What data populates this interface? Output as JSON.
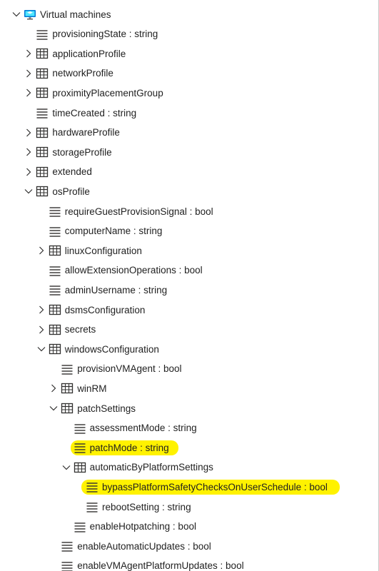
{
  "tree": {
    "nodes": [
      {
        "label": "Virtual machines",
        "depth": 0,
        "kind": "root",
        "chevron": "expanded",
        "name": "tree-root-virtual-machines"
      },
      {
        "label": "provisioningState : string",
        "depth": 1,
        "kind": "field",
        "chevron": "none",
        "name": "tree-field-provisioningstate"
      },
      {
        "label": "applicationProfile",
        "depth": 1,
        "kind": "table",
        "chevron": "collapsed",
        "name": "tree-node-applicationprofile"
      },
      {
        "label": "networkProfile",
        "depth": 1,
        "kind": "table",
        "chevron": "collapsed",
        "name": "tree-node-networkprofile"
      },
      {
        "label": "proximityPlacementGroup",
        "depth": 1,
        "kind": "table",
        "chevron": "collapsed",
        "name": "tree-node-proximityplacementgroup"
      },
      {
        "label": "timeCreated : string",
        "depth": 1,
        "kind": "field",
        "chevron": "none",
        "name": "tree-field-timecreated"
      },
      {
        "label": "hardwareProfile",
        "depth": 1,
        "kind": "table",
        "chevron": "collapsed",
        "name": "tree-node-hardwareprofile"
      },
      {
        "label": "storageProfile",
        "depth": 1,
        "kind": "table",
        "chevron": "collapsed",
        "name": "tree-node-storageprofile"
      },
      {
        "label": "extended",
        "depth": 1,
        "kind": "table",
        "chevron": "collapsed",
        "name": "tree-node-extended"
      },
      {
        "label": "osProfile",
        "depth": 1,
        "kind": "table",
        "chevron": "expanded",
        "name": "tree-node-osprofile"
      },
      {
        "label": "requireGuestProvisionSignal : bool",
        "depth": 2,
        "kind": "field",
        "chevron": "none",
        "name": "tree-field-requireguestprovisionsignal"
      },
      {
        "label": "computerName : string",
        "depth": 2,
        "kind": "field",
        "chevron": "none",
        "name": "tree-field-computername"
      },
      {
        "label": "linuxConfiguration",
        "depth": 2,
        "kind": "table",
        "chevron": "collapsed",
        "name": "tree-node-linuxconfiguration"
      },
      {
        "label": "allowExtensionOperations : bool",
        "depth": 2,
        "kind": "field",
        "chevron": "none",
        "name": "tree-field-allowextensionoperations"
      },
      {
        "label": "adminUsername : string",
        "depth": 2,
        "kind": "field",
        "chevron": "none",
        "name": "tree-field-adminusername"
      },
      {
        "label": "dsmsConfiguration",
        "depth": 2,
        "kind": "table",
        "chevron": "collapsed",
        "name": "tree-node-dsmsconfiguration"
      },
      {
        "label": "secrets",
        "depth": 2,
        "kind": "table",
        "chevron": "collapsed",
        "name": "tree-node-secrets"
      },
      {
        "label": "windowsConfiguration",
        "depth": 2,
        "kind": "table",
        "chevron": "expanded",
        "name": "tree-node-windowsconfiguration"
      },
      {
        "label": "provisionVMAgent : bool",
        "depth": 3,
        "kind": "field",
        "chevron": "none",
        "name": "tree-field-provisionvmagent"
      },
      {
        "label": "winRM",
        "depth": 3,
        "kind": "table",
        "chevron": "collapsed",
        "name": "tree-node-winrm"
      },
      {
        "label": "patchSettings",
        "depth": 3,
        "kind": "table",
        "chevron": "expanded",
        "name": "tree-node-patchsettings"
      },
      {
        "label": "assessmentMode : string",
        "depth": 4,
        "kind": "field",
        "chevron": "none",
        "name": "tree-field-assessmentmode"
      },
      {
        "label": "patchMode : string",
        "depth": 4,
        "kind": "field",
        "chevron": "none",
        "highlight": "mid",
        "name": "tree-field-patchmode"
      },
      {
        "label": "automaticByPlatformSettings",
        "depth": 4,
        "kind": "table",
        "chevron": "expanded",
        "name": "tree-node-automaticbyplatformsettings"
      },
      {
        "label": "bypassPlatformSafetyChecksOnUserSchedule : bool",
        "depth": 5,
        "kind": "field",
        "chevron": "none",
        "highlight": "wide",
        "name": "tree-field-bypassplatformsafetychecksonuserschedule"
      },
      {
        "label": "rebootSetting : string",
        "depth": 5,
        "kind": "field",
        "chevron": "none",
        "name": "tree-field-rebootsetting"
      },
      {
        "label": "enableHotpatching : bool",
        "depth": 4,
        "kind": "field",
        "chevron": "none",
        "name": "tree-field-enablehotpatching"
      },
      {
        "label": "enableAutomaticUpdates : bool",
        "depth": 3,
        "kind": "field",
        "chevron": "none",
        "name": "tree-field-enableautomaticupdates"
      },
      {
        "label": "enableVMAgentPlatformUpdates : bool",
        "depth": 3,
        "kind": "field",
        "chevron": "none",
        "name": "tree-field-enablevmagentplatformupdates"
      }
    ]
  },
  "icons": {
    "root": "virtual-machine-icon",
    "table": "table-icon",
    "field": "field-lines-icon",
    "expanded": "chevron-down-icon",
    "collapsed": "chevron-right-icon"
  },
  "colors": {
    "highlight": "#fff200",
    "text": "#1f1f1f",
    "icon": "#323130",
    "vm_blue": "#0078d4"
  }
}
